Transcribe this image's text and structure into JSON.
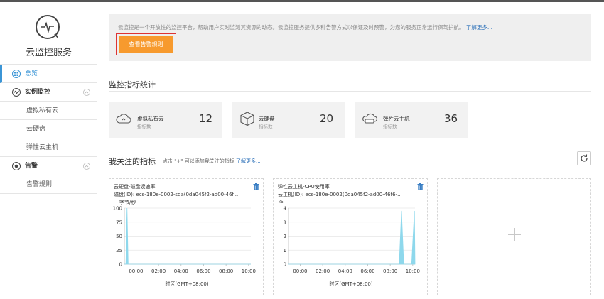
{
  "sidebar": {
    "title": "云监控服务",
    "items": [
      {
        "label": "总览",
        "icon": "overview-icon",
        "active": true
      },
      {
        "label": "实例监控",
        "icon": "monitor-wave-icon",
        "group": true
      },
      {
        "label": "虚拟私有云"
      },
      {
        "label": "云硬盘"
      },
      {
        "label": "弹性云主机"
      },
      {
        "label": "告警",
        "icon": "alarm-icon",
        "group": true
      },
      {
        "label": "告警规则"
      }
    ]
  },
  "notice": {
    "text": "云监控是一个开放性的监控平台，帮助用户实时监测其资源的动态。云监控服务提供多种告警方式以保证及时预警，为您的服务正常运行保驾护航。",
    "link": "了解更多...",
    "button": "查看告警规则"
  },
  "stats": {
    "title": "监控指标统计",
    "cards": [
      {
        "name": "虚拟私有云",
        "sub": "指标数",
        "value": "12",
        "icon": "cloud-vpc-icon"
      },
      {
        "name": "云硬盘",
        "sub": "指标数",
        "value": "20",
        "icon": "cube-disk-icon"
      },
      {
        "name": "弹性云主机",
        "sub": "指标数",
        "value": "36",
        "icon": "server-cloud-icon"
      }
    ]
  },
  "favorites": {
    "title": "我关注的指标",
    "hint": "点击 \"+\" 可以添加我关注的指标",
    "link": "了解更多..."
  },
  "chart_data": [
    {
      "type": "area",
      "title": "云硬盘-磁盘读速率",
      "subtitle": "磁盘(ID): ecs-180e-0002-sda(0da045f2-ad00-46f...",
      "ylabel": "字节/秒",
      "xlabel": "时区(GMT+08:00)",
      "ylim": [
        0,
        100
      ],
      "yticks": [
        "100",
        "75",
        "50",
        "25",
        "0"
      ],
      "xticks": [
        "00:00",
        "02:00",
        "04:00",
        "06:00",
        "08:00",
        "10:00"
      ],
      "x_hours": [
        -1.1,
        -0.9,
        -0.8,
        -0.7,
        10.2
      ],
      "y": [
        0,
        0,
        100,
        0,
        0
      ]
    },
    {
      "type": "area",
      "title": "弹性云主机-CPU使用率",
      "subtitle": "云主机(ID): ecs-180e-0002(0da045f2-ad00-46f6-...",
      "ylabel": "%",
      "xlabel": "时区(GMT+08:00)",
      "ylim": [
        0,
        4
      ],
      "yticks": [
        "4",
        "3",
        "2",
        "1",
        "0"
      ],
      "xticks": [
        "00:00",
        "02:00",
        "04:00",
        "06:00",
        "08:00",
        "10:00"
      ],
      "x_hours": [
        -1.1,
        8.8,
        9.0,
        9.2,
        9.9,
        10.15,
        10.2
      ],
      "y": [
        0,
        0,
        3.8,
        0,
        0,
        3.8,
        0
      ]
    }
  ],
  "colors": {
    "accent": "#3b95d6",
    "button": "#f79a2e",
    "area": "#8ed8ec",
    "link": "#2a6fb8"
  }
}
